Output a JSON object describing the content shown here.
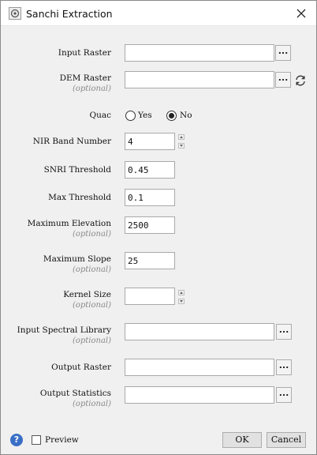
{
  "window": {
    "title": "Sanchi Extraction",
    "icon": "app-icon",
    "close_icon": "close-icon"
  },
  "form": {
    "input_raster": {
      "label": "Input Raster",
      "value": "",
      "browse_label": "..."
    },
    "dem_raster": {
      "label": "DEM Raster",
      "optional": "(optional)",
      "value": "",
      "browse_label": "...",
      "refresh_icon": "refresh-icon"
    },
    "quac": {
      "label": "Quac",
      "options": [
        {
          "label": "Yes",
          "checked": false
        },
        {
          "label": "No",
          "checked": true
        }
      ]
    },
    "nir_band_number": {
      "label": "NIR Band Number",
      "value": "4"
    },
    "snri_threshold": {
      "label": "SNRI Threshold",
      "value": "0.45"
    },
    "max_threshold": {
      "label": "Max Threshold",
      "value": "0.1"
    },
    "maximum_elevation": {
      "label": "Maximum Elevation",
      "optional": "(optional)",
      "value": "2500"
    },
    "maximum_slope": {
      "label": "Maximum Slope",
      "optional": "(optional)",
      "value": "25"
    },
    "kernel_size": {
      "label": "Kernel Size",
      "optional": "(optional)",
      "value": ""
    },
    "input_spectral_library": {
      "label": "Input Spectral Library",
      "optional": "(optional)",
      "value": "",
      "browse_label": "..."
    },
    "output_raster": {
      "label": "Output Raster",
      "value": "",
      "browse_label": "..."
    },
    "output_statistics": {
      "label": "Output Statistics",
      "optional": "(optional)",
      "value": "",
      "browse_label": "..."
    }
  },
  "footer": {
    "help_icon": "help-icon",
    "help_glyph": "?",
    "preview_label": "Preview",
    "preview_checked": false,
    "ok_label": "OK",
    "cancel_label": "Cancel"
  }
}
